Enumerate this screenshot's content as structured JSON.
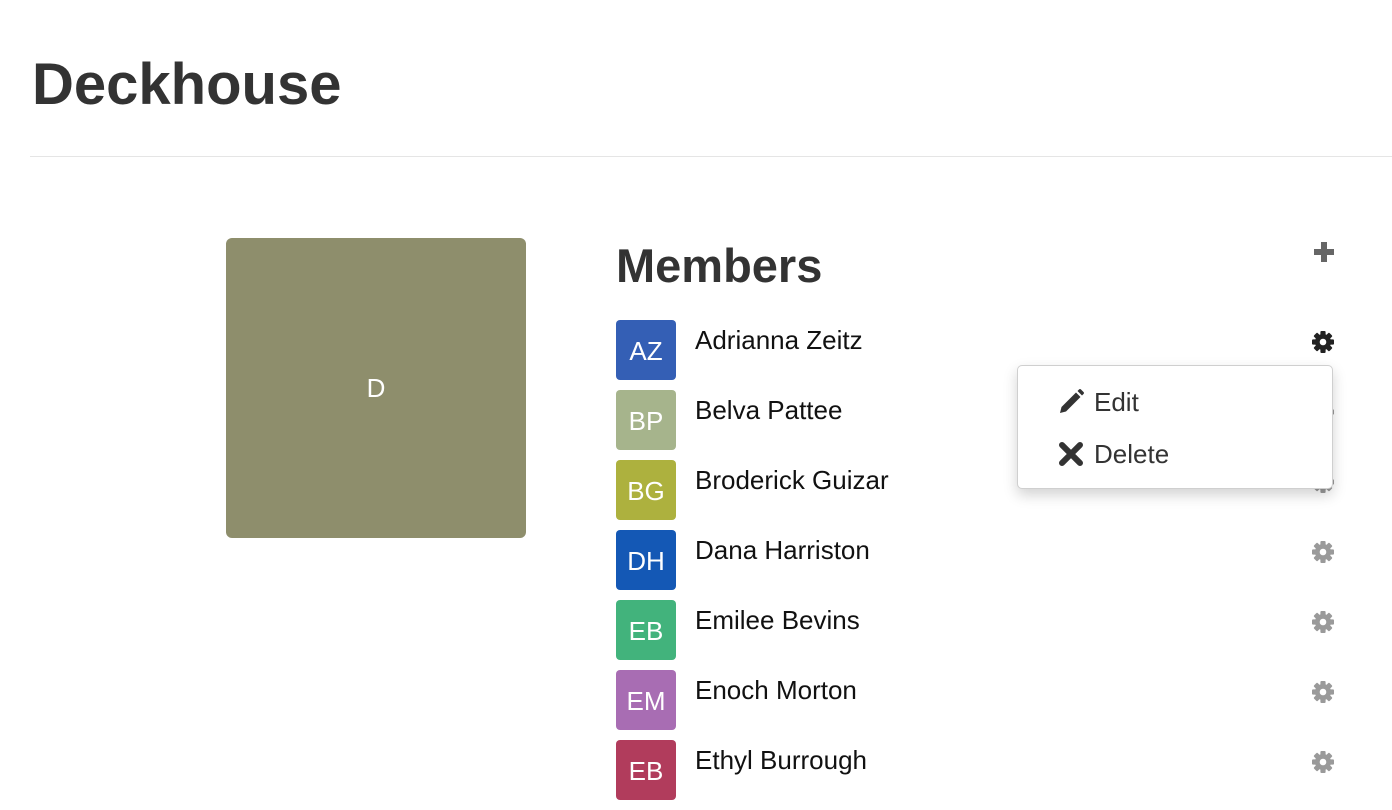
{
  "page": {
    "title": "Deckhouse"
  },
  "team": {
    "avatar_initial": "D",
    "avatar_color": "#8e8e6c"
  },
  "members_section": {
    "heading": "Members",
    "add_icon": "plus-icon",
    "members": [
      {
        "initials": "AZ",
        "name": "Adrianna Zeitz",
        "color": "#345fb5",
        "settings_icon": "gear-icon",
        "menu_open": true
      },
      {
        "initials": "BP",
        "name": "Belva Pattee",
        "color": "#a6b48c",
        "settings_icon": "gear-icon",
        "menu_open": false
      },
      {
        "initials": "BG",
        "name": "Broderick Guizar",
        "color": "#adb13e",
        "settings_icon": "gear-icon",
        "menu_open": false
      },
      {
        "initials": "DH",
        "name": "Dana Harriston",
        "color": "#1458b5",
        "settings_icon": "gear-icon",
        "menu_open": false
      },
      {
        "initials": "EB",
        "name": "Emilee Bevins",
        "color": "#42b37c",
        "settings_icon": "gear-icon",
        "menu_open": false
      },
      {
        "initials": "EM",
        "name": "Enoch Morton",
        "color": "#a86db3",
        "settings_icon": "gear-icon",
        "menu_open": false
      },
      {
        "initials": "EB",
        "name": "Ethyl Burrough",
        "color": "#b13c5c",
        "settings_icon": "gear-icon",
        "menu_open": false
      }
    ]
  },
  "member_menu": {
    "items": [
      {
        "label": "Edit",
        "icon": "pencil-icon"
      },
      {
        "label": "Delete",
        "icon": "remove-icon"
      }
    ]
  },
  "colors": {
    "gear_active": "#222222",
    "gear_inactive": "#9a9a9a",
    "plus": "#666666"
  }
}
